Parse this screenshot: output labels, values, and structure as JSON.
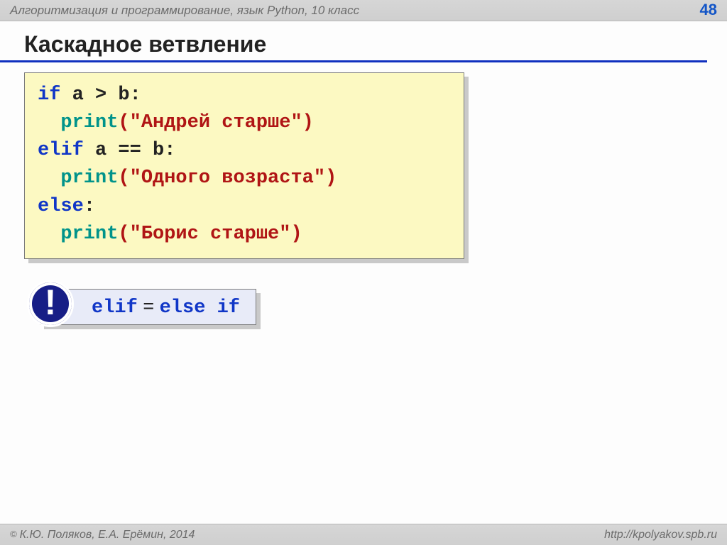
{
  "header": {
    "course": "Алгоритмизация и программирование, язык Python, 10 класс",
    "page": "48"
  },
  "title": "Каскадное ветвление",
  "code": {
    "l1_kw": "if",
    "l1_rest": " a > b:",
    "l2_fn": "print",
    "l2_str": "(\"Андрей старше\")",
    "l3_kw": "elif",
    "l3_rest": " a == b:",
    "l4_fn": "print",
    "l4_str": "(\"Одного возраста\")",
    "l5_kw": "else",
    "l5_colon": ":",
    "l6_fn": "print",
    "l6_str": "(\"Борис старше\")"
  },
  "note": {
    "bang": "!",
    "elif": "elif",
    "eq": " = ",
    "elseif": "else if"
  },
  "footer": {
    "authors": "К.Ю. Поляков, Е.А. Ерёмин, 2014",
    "url": "http://kpolyakov.spb.ru"
  }
}
